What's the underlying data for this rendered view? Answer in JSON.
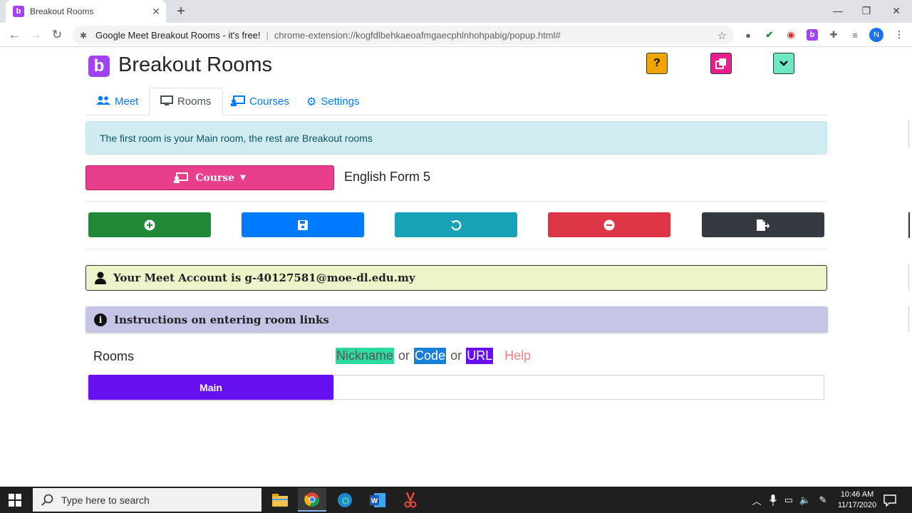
{
  "browser": {
    "tab_title": "Breakout Rooms",
    "tab_favicon_letter": "b",
    "site_name": "Google Meet Breakout Rooms - it's free!",
    "url": "chrome-extension://kogfdlbehkaeoafmgaecphlnhohpabig/popup.html#",
    "profile_initial": "N"
  },
  "app": {
    "logo_letter": "b",
    "title": "Breakout Rooms",
    "help_btn": "?",
    "colors": {
      "purple": "#a142f4",
      "orange": "#f0a500",
      "pink": "#e91e8c",
      "teal": "#6ee7c5"
    }
  },
  "tabs": [
    {
      "label": "Meet",
      "icon": "users-icon"
    },
    {
      "label": "Rooms",
      "icon": "desktop-icon",
      "active": true
    },
    {
      "label": "Courses",
      "icon": "chalkboard-teacher-icon"
    },
    {
      "label": "Settings",
      "icon": "gear-icon"
    }
  ],
  "info_text": "The first room is your Main room, the rest are Breakout rooms",
  "course": {
    "button_label": "Course",
    "selected": "English Form 5"
  },
  "actions": [
    {
      "name": "add-room-button",
      "icon": "plus-circle-icon",
      "color": "#218838"
    },
    {
      "name": "save-button",
      "icon": "save-icon",
      "color": "#007bff"
    },
    {
      "name": "reset-button",
      "icon": "undo-icon",
      "color": "#17a2b8"
    },
    {
      "name": "remove-room-button",
      "icon": "minus-circle-icon",
      "color": "#dc3545"
    },
    {
      "name": "export-button",
      "icon": "file-export-icon",
      "color": "#343a40"
    }
  ],
  "account_text": "Your Meet Account is g-40127581@moe-dl.edu.my",
  "instructions_text": "Instructions on entering room links",
  "rooms": {
    "label": "Rooms",
    "legend": {
      "nickname": "Nickname",
      "or1": "or",
      "code": "Code",
      "or2": "or",
      "url": "URL",
      "help": "Help"
    },
    "main_label": "Main",
    "main_value": ""
  },
  "taskbar": {
    "search_placeholder": "Type here to search",
    "time": "10:46 AM",
    "date": "11/17/2020"
  }
}
